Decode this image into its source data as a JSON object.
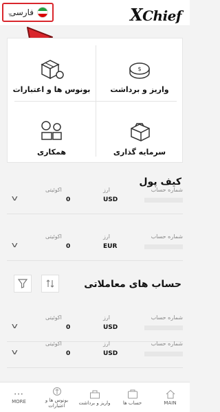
{
  "header": {
    "language_label": "فارسی",
    "logo": "XChief",
    "flag_colors": [
      "#239f40",
      "#ffffff",
      "#da0000"
    ]
  },
  "actions": [
    {
      "label": "بونوس ها و اعتبارات",
      "icon": "bonus-boxes-icon"
    },
    {
      "label": "واریز و برداشت",
      "icon": "coin-icon"
    },
    {
      "label": "همکاری",
      "icon": "partnership-icon"
    },
    {
      "label": "سرمایه گذاری",
      "icon": "briefcase-icon"
    }
  ],
  "wallet": {
    "title": "کیف پول",
    "col_account": "شماره حساب",
    "col_currency": "ارز",
    "col_equity": "اکوئیتی",
    "rows": [
      {
        "currency": "USD",
        "equity": "0"
      },
      {
        "currency": "EUR",
        "equity": "0"
      }
    ]
  },
  "trading": {
    "title": "حساب های معاملاتی",
    "col_account": "شماره حساب",
    "col_currency": "ارز",
    "col_equity": "اکوئیتی",
    "rows": [
      {
        "currency": "USD",
        "equity": "0"
      },
      {
        "currency": "USD",
        "equity": "0"
      }
    ]
  },
  "nav": {
    "main": "MAIN",
    "accounts": "حساب ها",
    "deposit": "واریز و برداشت",
    "bonus": "بونوس ها و اعتبارات",
    "more": "MORE"
  },
  "colors": {
    "highlight": "#d9262c",
    "text": "#111111",
    "muted": "#888888"
  }
}
